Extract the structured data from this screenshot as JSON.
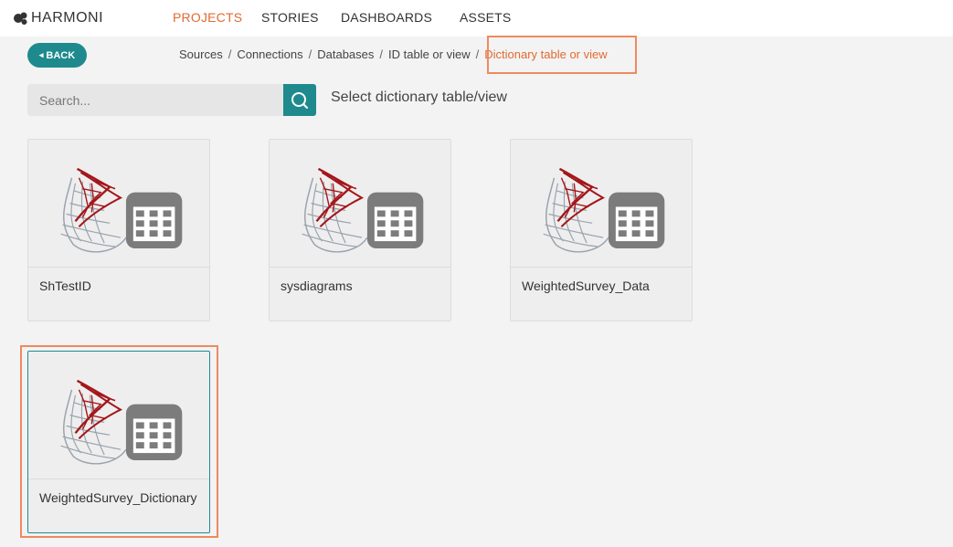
{
  "app": {
    "logo_text": "HARMONI"
  },
  "nav": {
    "items": [
      {
        "label": "PROJECTS",
        "active": true
      },
      {
        "label": "STORIES",
        "active": false
      },
      {
        "label": "DASHBOARDS",
        "active": false
      },
      {
        "label": "ASSETS",
        "active": false
      }
    ]
  },
  "toolbar": {
    "back_label": "BACK"
  },
  "breadcrumb": {
    "items": [
      "Sources",
      "Connections",
      "Databases",
      "ID table or view",
      "Dictionary table or view"
    ],
    "separator": "/"
  },
  "search": {
    "placeholder": "Search...",
    "value": ""
  },
  "prompt": "Select dictionary table/view",
  "cards": [
    {
      "label": "ShTestID",
      "icon": "sql-server-table-icon"
    },
    {
      "label": "sysdiagrams",
      "icon": "sql-server-table-icon"
    },
    {
      "label": "WeightedSurvey_Data",
      "icon": "sql-server-table-icon"
    },
    {
      "label": "WeightedSurvey_Dictionary",
      "icon": "sql-server-table-icon",
      "selected": true
    }
  ],
  "colors": {
    "accent": "#e06a32",
    "teal": "#1e8a8d",
    "highlight": "#ee8a5f"
  }
}
